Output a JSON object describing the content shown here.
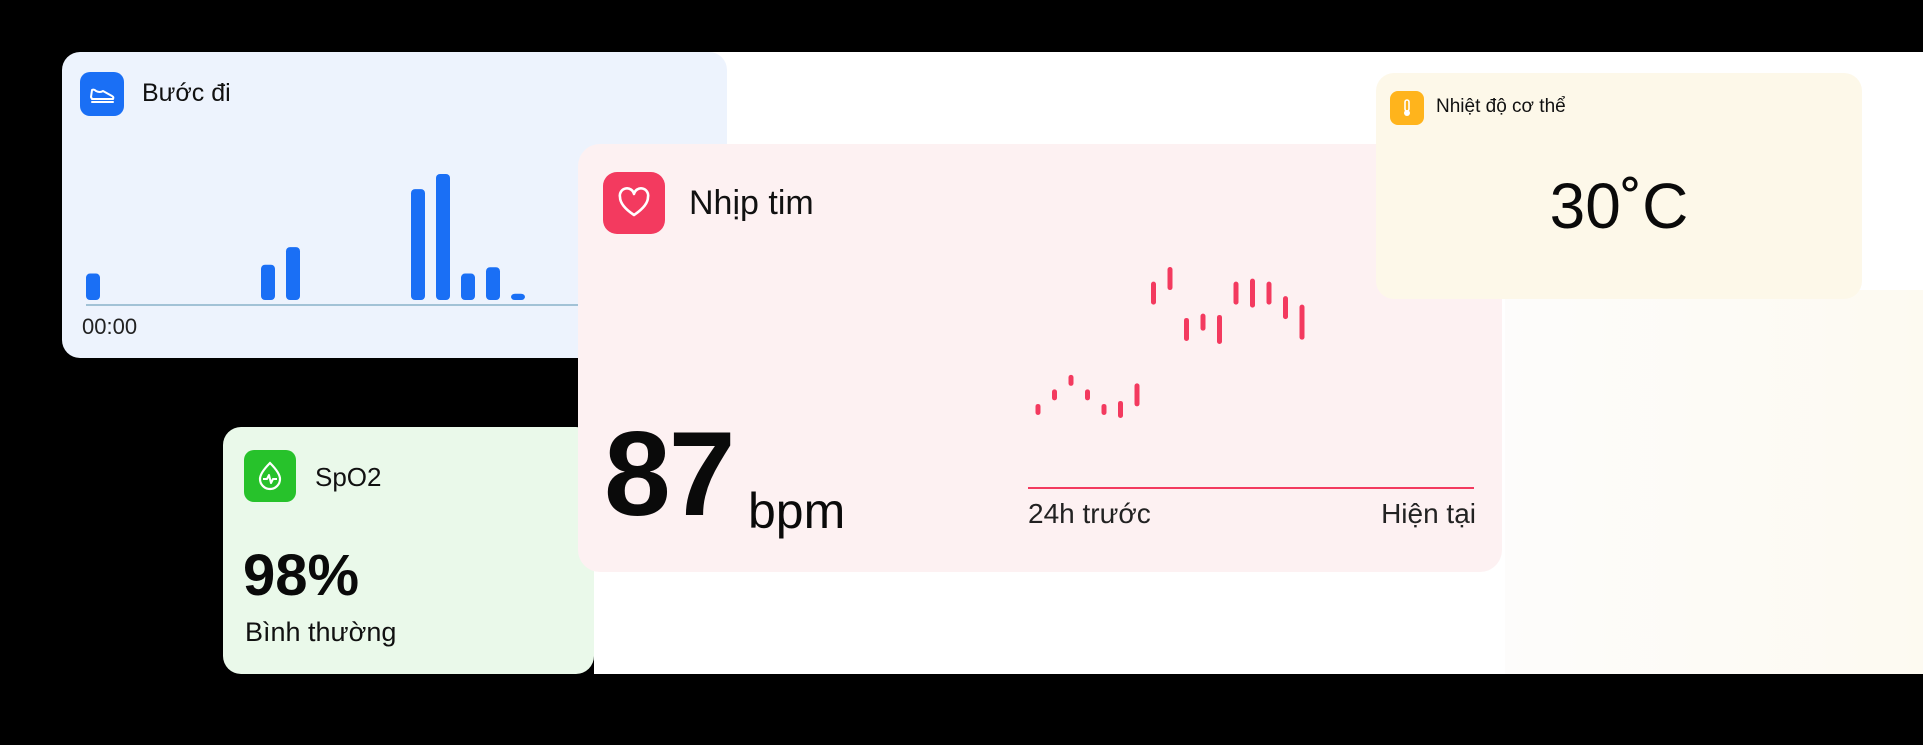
{
  "steps": {
    "title": "Bước đi",
    "time_label": "00:00",
    "bars": [
      0.21,
      0,
      0,
      0,
      0,
      0,
      0,
      0.28,
      0.42,
      0,
      0,
      0,
      0,
      0.88,
      1.0,
      0.21,
      0.26,
      0.05
    ],
    "color": "#1a6ff5",
    "icon": "shoe-icon"
  },
  "heart": {
    "title": "Nhịp tim",
    "value": "87",
    "unit": "bpm",
    "range_start": "24h trước",
    "range_end": "Hiện tại",
    "color": "#f33a5f",
    "icon": "heart-icon",
    "marks": [
      {
        "y": 72,
        "len": 2
      },
      {
        "y": 74,
        "len": 2
      },
      {
        "y": 76,
        "len": 2
      },
      {
        "y": 74,
        "len": 2
      },
      {
        "y": 72,
        "len": 2
      },
      {
        "y": 72,
        "len": 4
      },
      {
        "y": 74,
        "len": 6
      },
      {
        "y": 88,
        "len": 6
      },
      {
        "y": 90,
        "len": 6
      },
      {
        "y": 83,
        "len": 6
      },
      {
        "y": 84,
        "len": 4
      },
      {
        "y": 83,
        "len": 8
      },
      {
        "y": 88,
        "len": 6
      },
      {
        "y": 88,
        "len": 8
      },
      {
        "y": 88,
        "len": 6
      },
      {
        "y": 86,
        "len": 6
      },
      {
        "y": 84,
        "len": 10
      }
    ]
  },
  "temperature": {
    "title": "Nhiệt độ cơ thể",
    "value": "30˚C",
    "color": "#ffb41c",
    "icon": "thermometer-icon"
  },
  "spo2": {
    "title": "SpO2",
    "value": "98%",
    "status": "Bình thường",
    "color": "#27c22b",
    "icon": "oxygen-drop-icon"
  }
}
